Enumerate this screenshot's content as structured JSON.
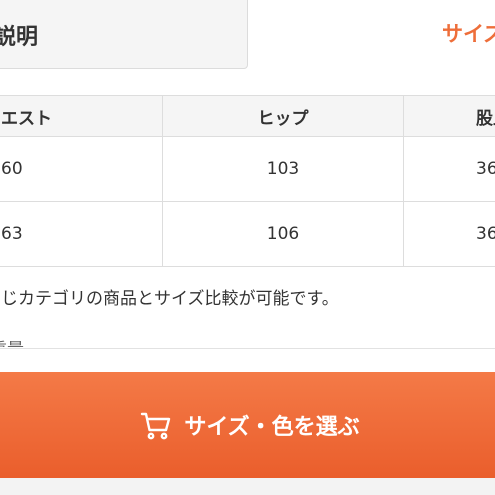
{
  "tabs": {
    "description_label": "説明",
    "size_label": "サイズ"
  },
  "size_table": {
    "headers": [
      "エスト",
      "ヒップ",
      "股上"
    ],
    "rows": [
      [
        "60",
        "103",
        "36"
      ],
      [
        "63",
        "106",
        "36"
      ]
    ]
  },
  "note": {
    "text": "同じカテゴリの商品とサイズ比較が可能です。",
    "clipped": "重量"
  },
  "cta": {
    "label": "サイズ・色を選ぶ",
    "icon": "cart-icon",
    "color": "#ee6e3a"
  },
  "colors": {
    "accent": "#ee6e3a",
    "header_bg": "#f5f5f5"
  }
}
